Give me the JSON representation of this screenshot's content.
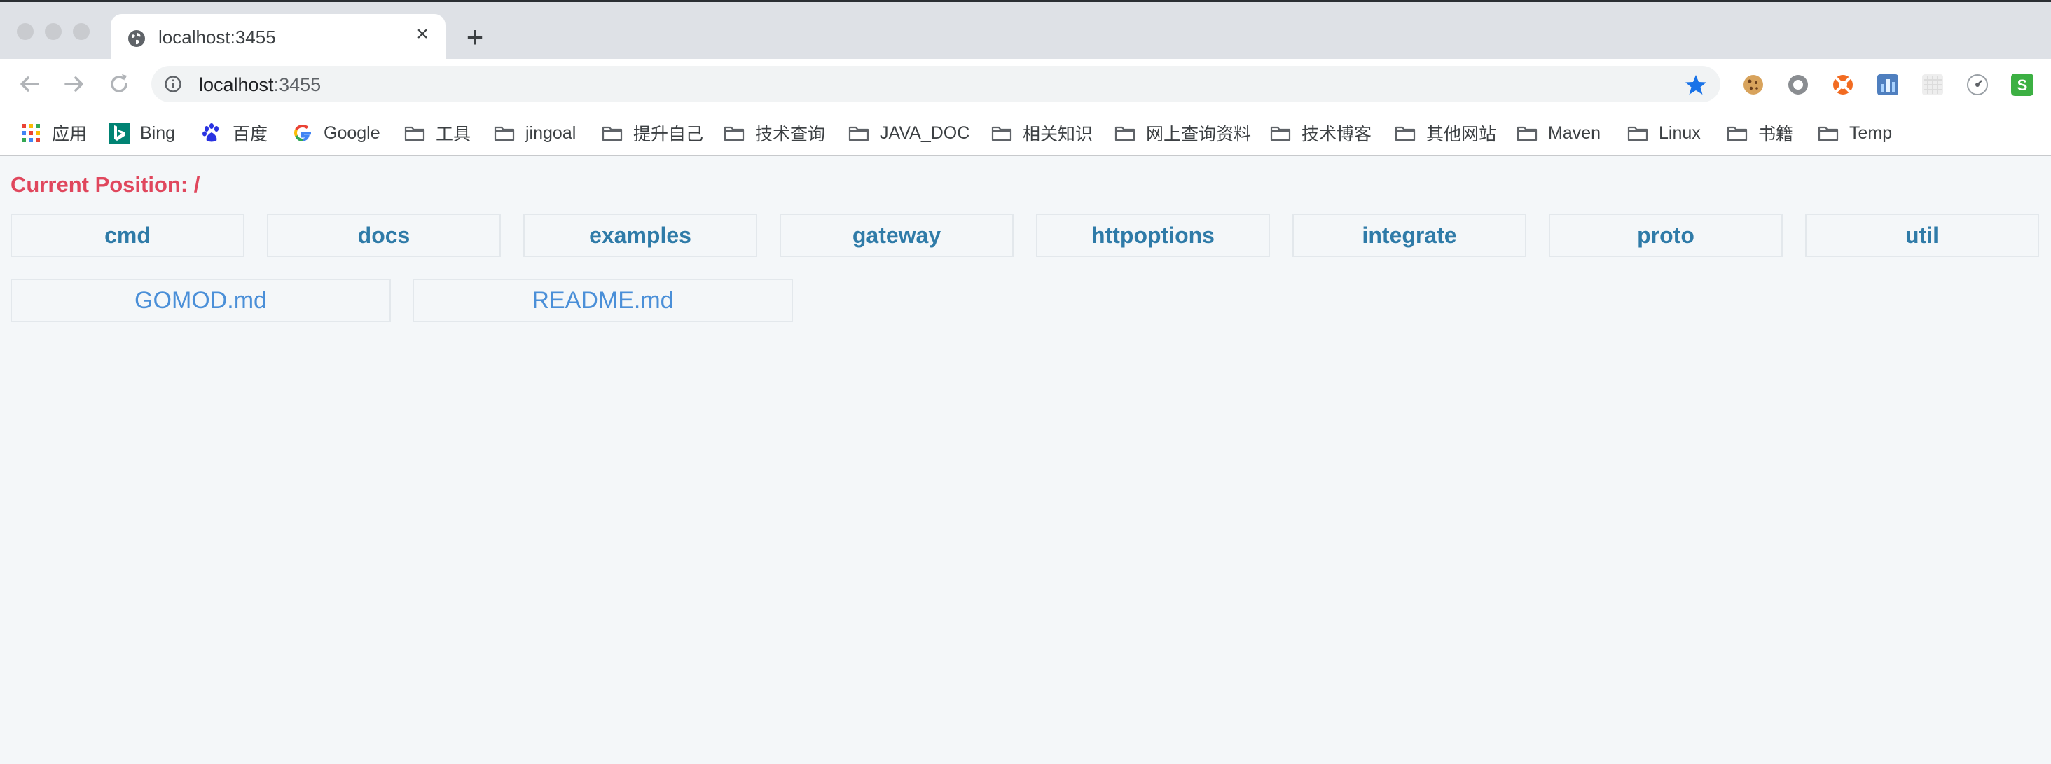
{
  "tab": {
    "title": "localhost:3455",
    "close": "×"
  },
  "new_tab": "+",
  "omnibox": {
    "host": "localhost",
    "port": ":3455"
  },
  "bookmarks": [
    {
      "label": "应用",
      "icon": "apps-grid-icon"
    },
    {
      "label": "Bing",
      "icon": "bing-icon"
    },
    {
      "label": "百度",
      "icon": "baidu-paw-icon"
    },
    {
      "label": "Google",
      "icon": "google-icon"
    },
    {
      "label": "工具",
      "icon": "folder-icon"
    },
    {
      "label": "jingoal",
      "icon": "folder-icon"
    },
    {
      "label": "提升自己",
      "icon": "folder-icon"
    },
    {
      "label": "技术查询",
      "icon": "folder-icon"
    },
    {
      "label": "JAVA_DOC",
      "icon": "folder-icon"
    },
    {
      "label": "相关知识",
      "icon": "folder-icon"
    },
    {
      "label": "网上查询资料",
      "icon": "folder-icon"
    },
    {
      "label": "技术博客",
      "icon": "folder-icon"
    },
    {
      "label": "其他网站",
      "icon": "folder-icon"
    },
    {
      "label": "Maven",
      "icon": "folder-icon"
    },
    {
      "label": "Linux",
      "icon": "folder-icon"
    },
    {
      "label": "书籍",
      "icon": "folder-icon"
    },
    {
      "label": "Temp",
      "icon": "folder-icon"
    }
  ],
  "extensions": [
    "cookie-icon",
    "circle-record-icon",
    "lifebuoy-icon",
    "chart-extension-icon",
    "grid-extension-icon",
    "clock-extension-icon",
    "s-extension-icon"
  ],
  "colors": {
    "position_text": "#e0475d",
    "directory_text": "#2f7ba8",
    "file_text": "#4a8fd8",
    "page_background": "#f4f7f9",
    "star": "#1a73e8"
  },
  "page": {
    "current_position": "Current Position: /",
    "directories": [
      "cmd",
      "docs",
      "examples",
      "gateway",
      "httpoptions",
      "integrate",
      "proto",
      "util"
    ],
    "files": [
      "GOMOD.md",
      "README.md"
    ]
  }
}
